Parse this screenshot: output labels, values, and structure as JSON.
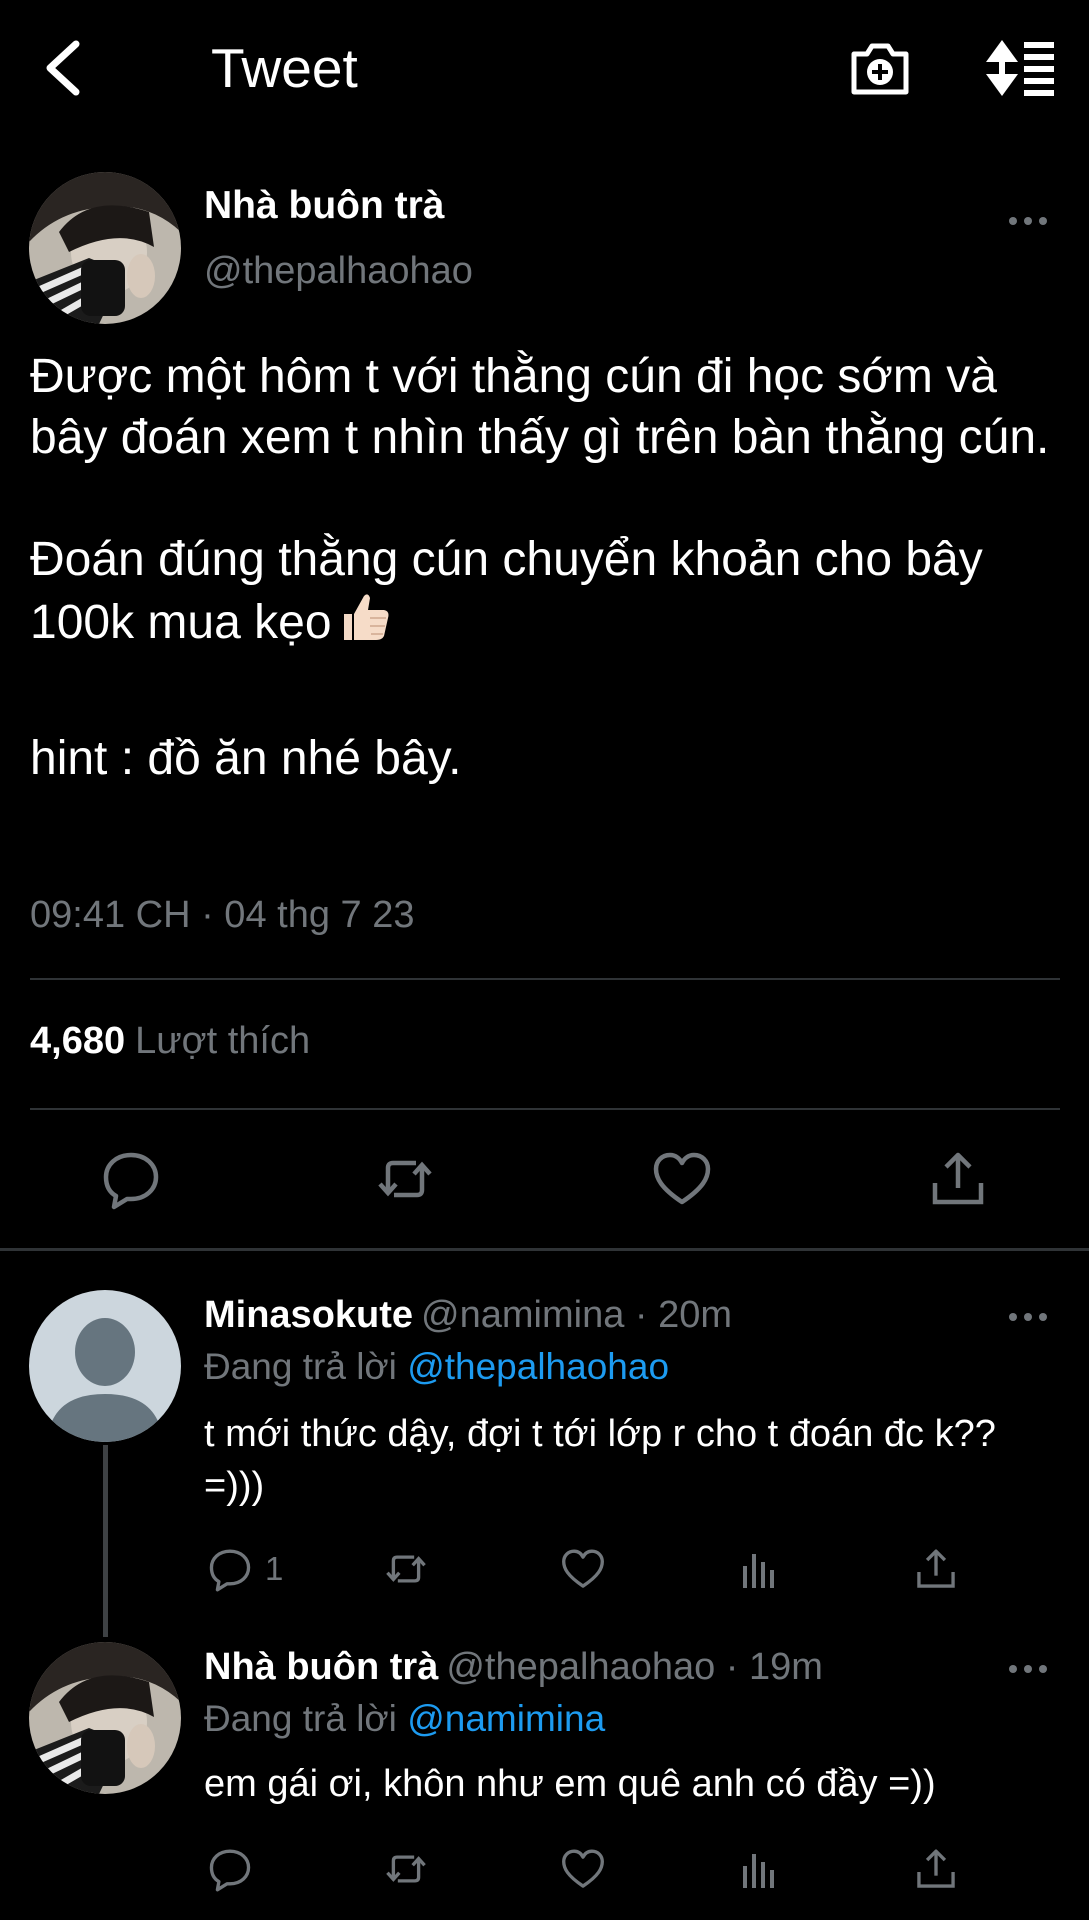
{
  "header": {
    "title": "Tweet",
    "back_icon": "chevron-left-icon",
    "camera_icon": "camera-add-icon",
    "sort_icon": "sort-icon"
  },
  "main_tweet": {
    "author_name": "Nhà buôn trà",
    "author_handle": "@thepalhaohao",
    "text_lines": [
      "Được một hôm t với thằng cún đi học sớm và bây đoán xem t nhìn thấy gì trên bàn thằng cún.",
      "Đoán đúng thằng cún chuyển khoản cho bây 100k mua kẹo",
      "hint : đồ ăn nhé bây."
    ],
    "timestamp": "09:41 CH · 04 thg 7 23",
    "likes_count": "4,680",
    "likes_label": "Lượt thích"
  },
  "replies": [
    {
      "name": "Minasokute",
      "handle_time": "@namimina · 20m",
      "replying_prefix": "Đang trả lời",
      "replying_to": "@thepalhaohao",
      "text": "t mới thức dậy, đợi t tới lớp r cho t đoán đc k?? =)))",
      "reply_count": "1"
    },
    {
      "name": "Nhà buôn trà",
      "handle_time": "@thepalhaohao · 19m",
      "replying_prefix": "Đang trả lời",
      "replying_to": "@namimina",
      "text": "em gái ơi, khôn như em quê anh có đầy =))"
    }
  ],
  "colors": {
    "background": "#000000",
    "text": "#ffffff",
    "secondary_text": "#71767b",
    "accent": "#1d9bf0",
    "divider": "#2f3336"
  }
}
